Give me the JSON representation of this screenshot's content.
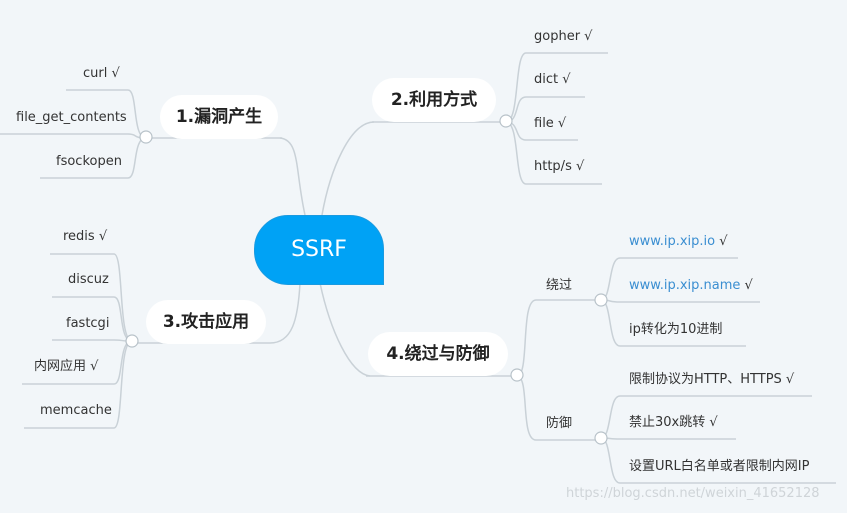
{
  "root": {
    "label": "SSRF"
  },
  "branches": [
    {
      "label": "1.漏洞产生",
      "leaves": [
        "curl √",
        "file_get_contents",
        "fsockopen"
      ]
    },
    {
      "label": "2.利用方式",
      "leaves": [
        "gopher √",
        "dict √",
        "file √",
        "http/s √"
      ]
    },
    {
      "label": "3.攻击应用",
      "leaves": [
        "redis √",
        "discuz",
        "fastcgi",
        "内网应用 √",
        "memcache"
      ]
    },
    {
      "label": "4.绕过与防御",
      "groups": [
        {
          "label": "绕过",
          "leaves": [
            {
              "link": "www.ip.xip.io",
              "suffix": " √"
            },
            {
              "link": "www.ip.xip.name",
              "suffix": " √"
            },
            {
              "text": "ip转化为10进制"
            }
          ]
        },
        {
          "label": "防御",
          "leaves": [
            {
              "text": "限制协议为HTTP、HTTPS √"
            },
            {
              "text": "禁止30x跳转 √"
            },
            {
              "text": "设置URL白名单或者限制内网IP"
            }
          ]
        }
      ]
    }
  ],
  "watermark": "https://blog.csdn.net/weixin_41652128",
  "colors": {
    "central_fill": "#00a2f5",
    "branch_fill": "#ffffff",
    "line": "#c9d1d7",
    "link_text": "#3a8ed1",
    "background": "#f2f6f9"
  }
}
